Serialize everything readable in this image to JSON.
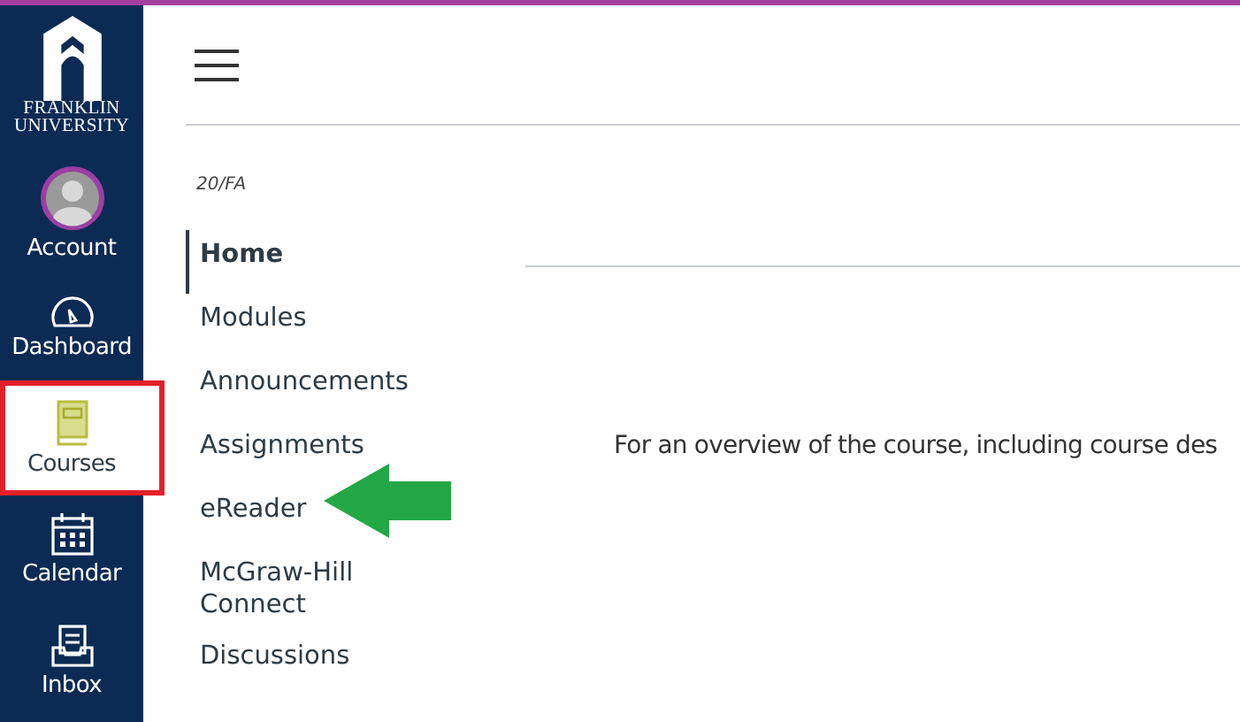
{
  "logo": {
    "lines": [
      "FRANKLIN",
      "UNIVERSITY"
    ]
  },
  "global_nav": [
    {
      "label": "Account",
      "selected": false
    },
    {
      "label": "Dashboard",
      "selected": false
    },
    {
      "label": "Courses",
      "selected": true
    },
    {
      "label": "Calendar",
      "selected": false
    },
    {
      "label": "Inbox",
      "selected": false
    }
  ],
  "term": "20/FA",
  "course_nav": [
    {
      "label": "Home",
      "selected": true
    },
    {
      "label": "Modules",
      "selected": false
    },
    {
      "label": "Announcements",
      "selected": false
    },
    {
      "label": "Assignments",
      "selected": false
    },
    {
      "label": "eReader",
      "selected": false
    },
    {
      "label": "McGraw-Hill Connect",
      "selected": false
    },
    {
      "label": "Discussions",
      "selected": false
    }
  ],
  "content": {
    "text": "For an overview of the course, including course des"
  },
  "annotations": {
    "frame_on_selected_nav": true,
    "arrow_to_course_link": true
  }
}
